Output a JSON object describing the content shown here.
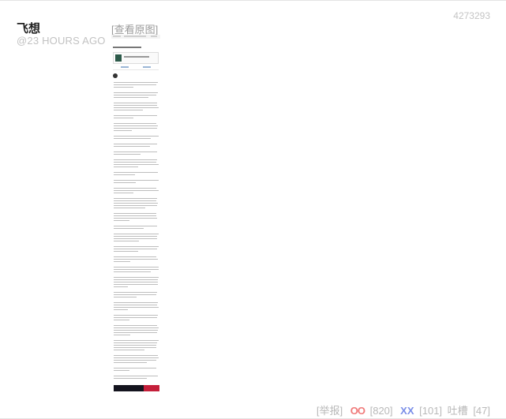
{
  "post": {
    "author": "飞想",
    "time": "@23 HOURS AGO",
    "view_original": "[查看原图]",
    "id": "4273293"
  },
  "footer": {
    "report": "[举报]",
    "oo_label": "OO",
    "oo_count": "[820]",
    "xx_label": "XX",
    "xx_count": "[101]",
    "comments_label": "吐槽",
    "comments_count": "[47]"
  },
  "colors": {
    "oo": "#f07a7a",
    "xx": "#7b8fe8",
    "muted": "#b9b9b9"
  },
  "thumbnail": {
    "description_icon": "screenshot-thumbnail-icon"
  }
}
